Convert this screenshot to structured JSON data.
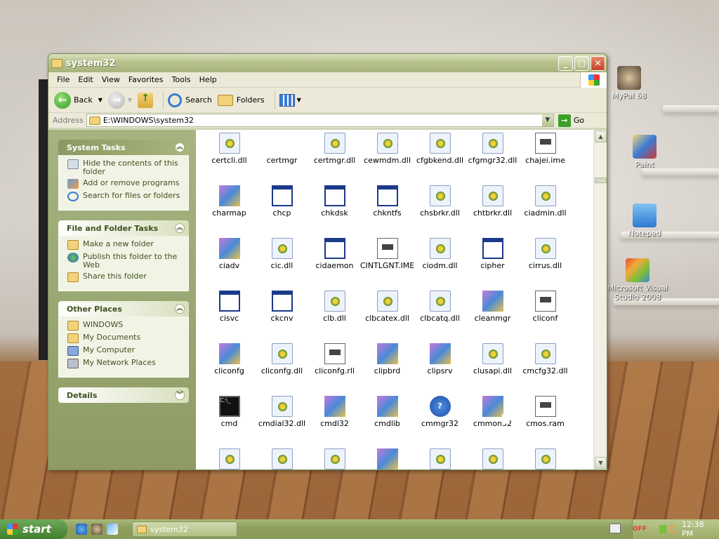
{
  "desktop": {
    "icons": [
      {
        "label": "MyPal 68",
        "icon": "raccoon-icon"
      },
      {
        "label": "Paint",
        "icon": "paint-icon"
      },
      {
        "label": "Notepad",
        "icon": "notepad-icon"
      },
      {
        "label": "Microsoft Visual Studio 2008",
        "icon": "visual-studio-icon"
      }
    ]
  },
  "window": {
    "title": "system32",
    "menu": [
      "File",
      "Edit",
      "View",
      "Favorites",
      "Tools",
      "Help"
    ],
    "toolbar": {
      "back": "Back",
      "search": "Search",
      "folders": "Folders"
    },
    "address": {
      "label": "Address",
      "value": "E:\\WINDOWS\\system32",
      "go": "Go"
    },
    "tasks": {
      "system_title": "System Tasks",
      "system_items": [
        "Hide the contents of this folder",
        "Add or remove programs",
        "Search for files or folders"
      ],
      "file_title": "File and Folder Tasks",
      "file_items": [
        "Make a new folder",
        "Publish this folder to the Web",
        "Share this folder"
      ],
      "other_title": "Other Places",
      "other_items": [
        "WINDOWS",
        "My Documents",
        "My Computer",
        "My Network Places"
      ],
      "details_title": "Details"
    },
    "files": [
      {
        "name": "certcli.dll",
        "kind": "dll"
      },
      {
        "name": "certmgr",
        "kind": "cert"
      },
      {
        "name": "certmgr.dll",
        "kind": "dll"
      },
      {
        "name": "cewmdm.dll",
        "kind": "dll"
      },
      {
        "name": "cfgbkend.dll",
        "kind": "dll"
      },
      {
        "name": "cfgmgr32.dll",
        "kind": "dll"
      },
      {
        "name": "chajei.ime",
        "kind": "txt"
      },
      {
        "name": "charmap",
        "kind": "color"
      },
      {
        "name": "chcp",
        "kind": "exe"
      },
      {
        "name": "chkdsk",
        "kind": "exe"
      },
      {
        "name": "chkntfs",
        "kind": "exe"
      },
      {
        "name": "chsbrkr.dll",
        "kind": "dll"
      },
      {
        "name": "chtbrkr.dll",
        "kind": "dll"
      },
      {
        "name": "ciadmin.dll",
        "kind": "dll"
      },
      {
        "name": "ciadv",
        "kind": "color"
      },
      {
        "name": "cic.dll",
        "kind": "dll"
      },
      {
        "name": "cidaemon",
        "kind": "exe"
      },
      {
        "name": "CINTLGNT.IME",
        "kind": "txt"
      },
      {
        "name": "ciodm.dll",
        "kind": "dll"
      },
      {
        "name": "cipher",
        "kind": "exe"
      },
      {
        "name": "cirrus.dll",
        "kind": "dll"
      },
      {
        "name": "cisvc",
        "kind": "exe"
      },
      {
        "name": "ckcnv",
        "kind": "exe"
      },
      {
        "name": "clb.dll",
        "kind": "dll"
      },
      {
        "name": "clbcatex.dll",
        "kind": "dll"
      },
      {
        "name": "clbcatq.dll",
        "kind": "dll"
      },
      {
        "name": "cleanmgr",
        "kind": "color"
      },
      {
        "name": "cliconf",
        "kind": "txt"
      },
      {
        "name": "cliconfg",
        "kind": "color"
      },
      {
        "name": "cliconfg.dll",
        "kind": "dll"
      },
      {
        "name": "cliconfg.rll",
        "kind": "txt"
      },
      {
        "name": "clipbrd",
        "kind": "color"
      },
      {
        "name": "clipsrv",
        "kind": "color"
      },
      {
        "name": "clusapi.dll",
        "kind": "dll"
      },
      {
        "name": "cmcfg32.dll",
        "kind": "dll"
      },
      {
        "name": "cmd",
        "kind": "black"
      },
      {
        "name": "cmdial32.dll",
        "kind": "dll"
      },
      {
        "name": "cmdl32",
        "kind": "color"
      },
      {
        "name": "cmdlib",
        "kind": "color"
      },
      {
        "name": "cmmgr32",
        "kind": "q"
      },
      {
        "name": "cmmon32",
        "kind": "color"
      },
      {
        "name": "cmos.ram",
        "kind": "txt"
      },
      {
        "name": "",
        "kind": "dll"
      },
      {
        "name": "",
        "kind": "dll"
      },
      {
        "name": "",
        "kind": "dll"
      },
      {
        "name": "",
        "kind": "color"
      },
      {
        "name": "",
        "kind": "dll"
      },
      {
        "name": "",
        "kind": "dll"
      },
      {
        "name": "",
        "kind": "dll"
      }
    ]
  },
  "taskbar": {
    "start": "start",
    "window_item": "system32",
    "tray_off": "OFF",
    "clock": "12:38 PM"
  }
}
